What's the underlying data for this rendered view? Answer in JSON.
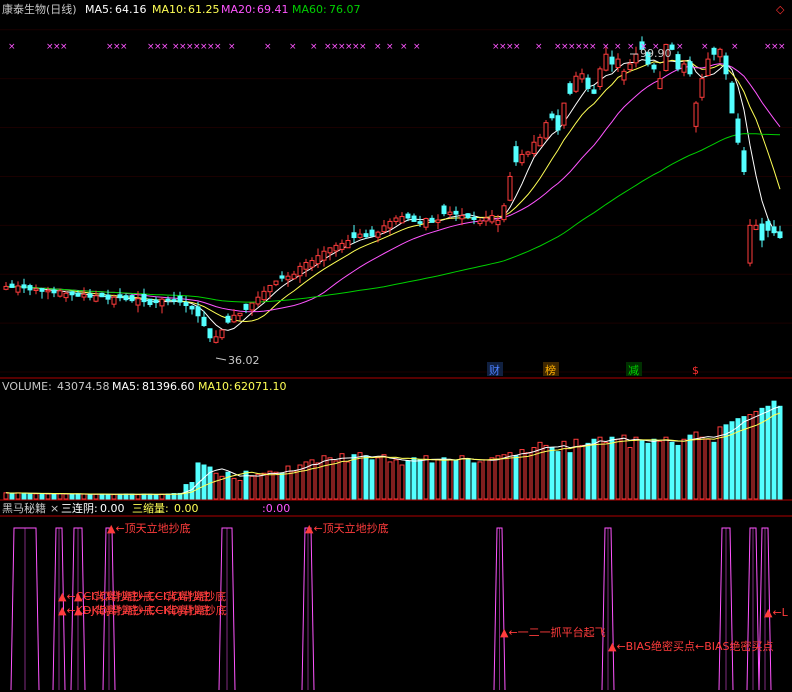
{
  "header": {
    "title": "康泰生物(日线)",
    "ma5_label": "MA5:",
    "ma5_value": "64.16",
    "ma10_label": "MA10:",
    "ma10_value": "61.25",
    "ma20_label": "MA20:",
    "ma20_value": "69.41",
    "ma60_label": "MA60:",
    "ma60_value": "76.07",
    "corner_icon": "◇"
  },
  "price_panel": {
    "high_marker": "99.90",
    "low_marker": "36.02",
    "event_tags": [
      {
        "text": "财",
        "color": "#4a7fff"
      },
      {
        "text": "榜",
        "color": "#ffb000"
      },
      {
        "text": "减",
        "color": "#00d000"
      },
      {
        "text": "$",
        "color": "#ff3030"
      }
    ]
  },
  "volume_panel": {
    "label": "VOLUME:",
    "value": "43074.58",
    "ma5_label": "MA5:",
    "ma5_value": "81396.60",
    "ma10_label": "MA10:",
    "ma10_value": "62071.10"
  },
  "indicator_panel": {
    "name": "黑马秘籍",
    "close_icon": "×",
    "s1_label": "三连阴:",
    "s1_value": "0.00",
    "s2_label": "三缩量:",
    "s2_value": "0.00",
    "s3_value": ":0.00",
    "signals": [
      {
        "text": "▲←顶天立地抄底"
      },
      {
        "text": "▲←顶天立地抄底"
      },
      {
        "text": "▲←CCI背离抄底←CCI背离抄底"
      },
      {
        "text": "▲←CCI背离抄底←CCI背离抄底"
      },
      {
        "text": "▲←KDJ背离抄底←CCI背离抄底"
      },
      {
        "text": "▲←KDJ背离抄底←KDJ背离抄底"
      },
      {
        "text": "▲←一二一抓平台起飞"
      },
      {
        "text": "▲←BIAS绝密买点←BIAS绝密买点"
      },
      {
        "text": "▲←L"
      }
    ]
  },
  "colors": {
    "up": "#ff3c3c",
    "down": "#54ffff",
    "ma5": "#ffffff",
    "ma10": "#ffff55",
    "ma20": "#ff55ff",
    "ma60": "#00d000",
    "signal": "#ff3c3c",
    "pulse": "#ff55ff",
    "divider": "#b00000"
  },
  "chart_data": {
    "type": "candlestick",
    "ylim": [
      30,
      102
    ],
    "count": 130,
    "close": [
      47.5,
      47.3,
      47.6,
      47.2,
      46.8,
      47.0,
      46.5,
      46.7,
      46.2,
      46.6,
      46.1,
      45.8,
      45.5,
      45.9,
      45.3,
      45.6,
      45.4,
      44.9,
      45.3,
      45.2,
      44.8,
      44.6,
      45.0,
      44.4,
      43.8,
      44.2,
      44.9,
      44.6,
      44.5,
      44.3,
      43.6,
      42.9,
      41.5,
      39.5,
      37.0,
      37.2,
      38.6,
      40.2,
      41.6,
      42.0,
      42.8,
      44.1,
      45.3,
      46.5,
      47.7,
      48.6,
      49.2,
      49.6,
      50.0,
      51.6,
      52.4,
      52.8,
      53.8,
      54.7,
      55.4,
      55.9,
      56.3,
      56.9,
      57.5,
      58.2,
      57.7,
      57.8,
      58.6,
      59.9,
      60.8,
      61.5,
      61.8,
      61.5,
      60.8,
      60.4,
      61.4,
      60.6,
      61.1,
      62.4,
      62.7,
      62.3,
      62.0,
      61.6,
      61.2,
      60.9,
      61.5,
      62.0,
      61.0,
      64.0,
      70.0,
      73.0,
      74.5,
      75.0,
      77.0,
      78.0,
      81.0,
      82.0,
      79.5,
      85.0,
      87.0,
      90.5,
      91.0,
      88.0,
      87.0,
      92.0,
      95.0,
      93.0,
      94.0,
      91.5,
      93.0,
      95.0,
      96.0,
      93.0,
      92.0,
      90.0,
      97.0,
      96.0,
      92.0,
      93.0,
      91.0,
      85.0,
      90.0,
      94.0,
      95.0,
      96.0,
      91.0,
      83.0,
      77.0,
      71.0,
      60.0,
      60.0,
      57.0,
      59.0,
      58.5,
      57.5
    ],
    "volume": [
      6000,
      5500,
      6000,
      5800,
      4800,
      5000,
      5200,
      4900,
      5200,
      5100,
      4800,
      4600,
      5000,
      4700,
      4400,
      4600,
      4800,
      4500,
      4300,
      4500,
      4800,
      4700,
      4200,
      4700,
      4600,
      4300,
      4700,
      4800,
      5300,
      5400,
      14000,
      16000,
      35000,
      33000,
      31000,
      25000,
      22000,
      26000,
      20000,
      18000,
      27000,
      22000,
      24000,
      25000,
      27000,
      26000,
      25000,
      32000,
      27000,
      33000,
      36000,
      38000,
      35000,
      42000,
      40000,
      37000,
      44000,
      36000,
      43000,
      45000,
      42000,
      38000,
      40000,
      43000,
      36000,
      38000,
      33000,
      37000,
      40000,
      38000,
      42000,
      35000,
      38000,
      40000,
      38000,
      38000,
      42000,
      39000,
      35000,
      36000,
      38000,
      40000,
      42000,
      43000,
      45000,
      42000,
      48000,
      45000,
      50000,
      55000,
      52000,
      50000,
      46000,
      56000,
      45000,
      58000,
      52000,
      54000,
      58000,
      60000,
      55000,
      60000,
      58000,
      62000,
      50000,
      60000,
      57000,
      54000,
      58000,
      56000,
      60000,
      55000,
      52000,
      58000,
      62000,
      65000,
      60000,
      58000,
      55000,
      70000,
      72000,
      75000,
      78000,
      80000,
      82000,
      85000,
      88000,
      90000,
      95000,
      90000
    ]
  }
}
